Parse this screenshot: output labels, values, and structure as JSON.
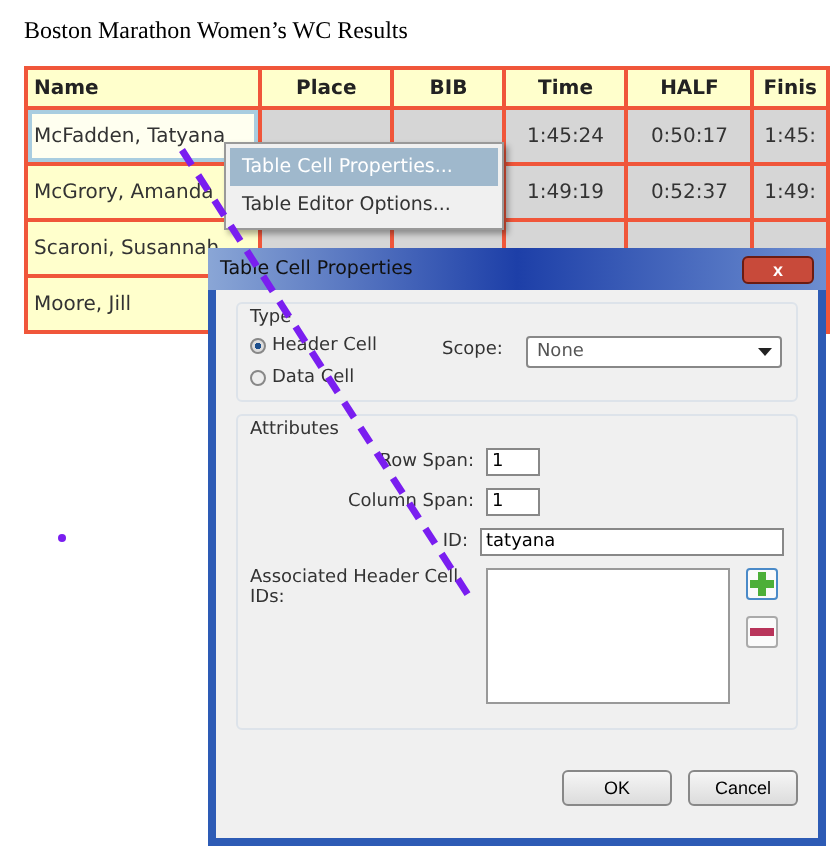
{
  "document": {
    "title": "Boston Marathon Women’s WC Results"
  },
  "table": {
    "columns": [
      "Name",
      "Place",
      "BIB",
      "Time",
      "HALF",
      "Finis"
    ],
    "rows": [
      {
        "selected": true,
        "name": "McFadden, Tatyana",
        "time": "1:45:24",
        "half": "0:50:17",
        "finish": "1:45:"
      },
      {
        "selected": false,
        "name": "McGrory, Amanda",
        "time": "1:49:19",
        "half": "0:52:37",
        "finish": "1:49:"
      },
      {
        "selected": false,
        "name": "Scaroni, Susannah"
      },
      {
        "selected": false,
        "name": "Moore, Jill"
      }
    ]
  },
  "context_menu": {
    "items": [
      {
        "label": "Table Cell Properties...",
        "selected": true
      },
      {
        "label": "Table Editor Options...",
        "selected": false
      }
    ]
  },
  "dialog": {
    "title": "Table Cell Properties",
    "close": "x",
    "type_group": {
      "label": "Type",
      "options": [
        {
          "label": "Header Cell",
          "selected": true
        },
        {
          "label": "Data Cell",
          "selected": false
        }
      ],
      "scope_label": "Scope:",
      "scope_value": "None"
    },
    "attributes_group": {
      "label": "Attributes",
      "row_span_label": "Row Span:",
      "row_span": "1",
      "column_span_label": "Column Span:",
      "column_span": "1",
      "id_label": "ID:",
      "id": "tatyana",
      "header_ids_label": "Associated Header Cell IDs:"
    },
    "buttons": [
      "OK",
      "Cancel"
    ]
  }
}
